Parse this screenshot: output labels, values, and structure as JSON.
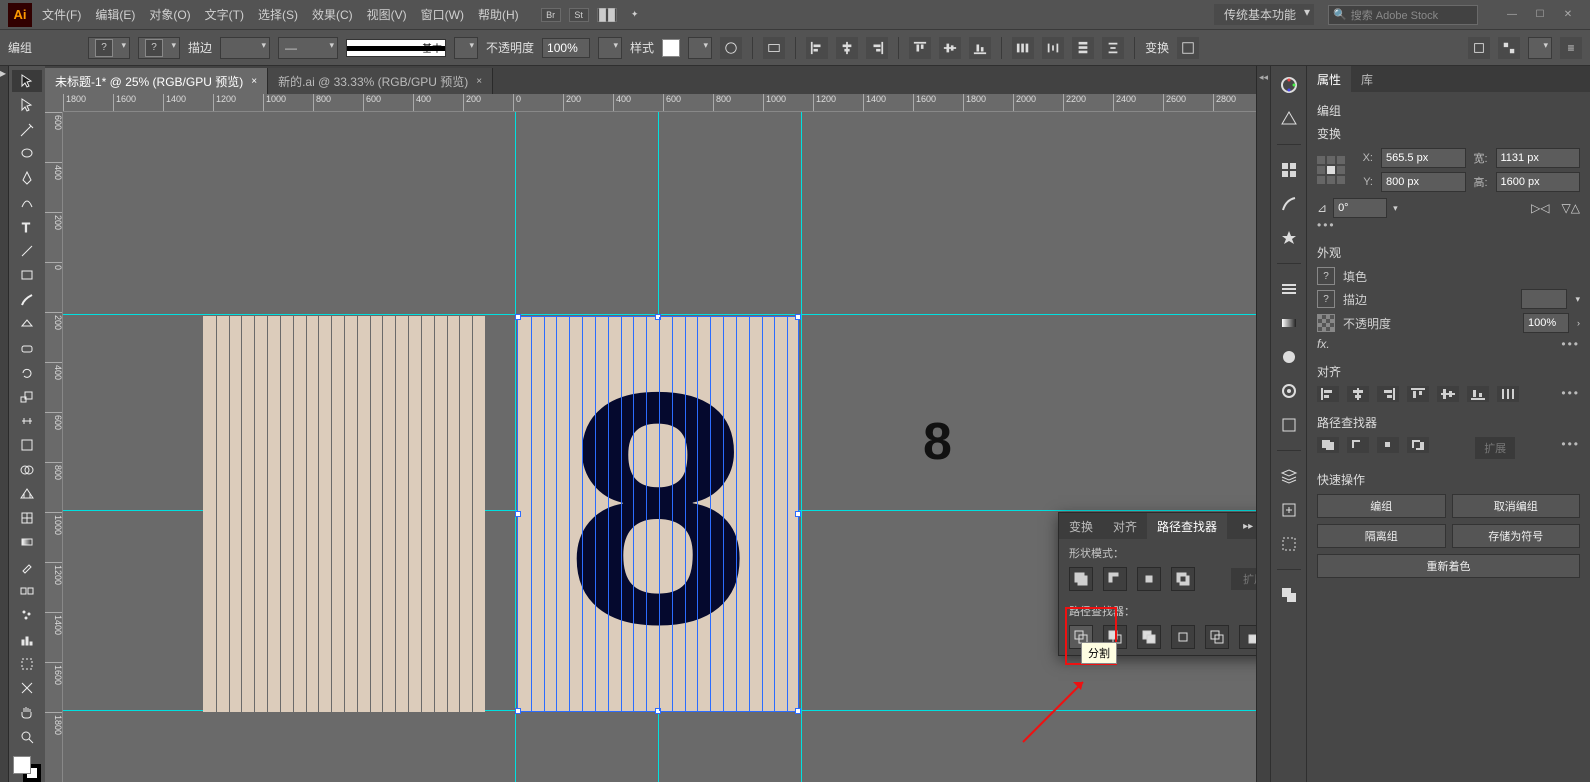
{
  "menu": {
    "items": [
      "文件(F)",
      "编辑(E)",
      "对象(O)",
      "文字(T)",
      "选择(S)",
      "效果(C)",
      "视图(V)",
      "窗口(W)",
      "帮助(H)"
    ],
    "br": "Br",
    "st": "St",
    "workspace": "传统基本功能",
    "search_placeholder": "搜索 Adobe Stock"
  },
  "options": {
    "sel_label": "编组",
    "stroke_label": "描边",
    "stroke_dash": "—",
    "basic": "基本",
    "opacity_label": "不透明度",
    "opacity": "100%",
    "style_label": "样式",
    "transform_label": "变换"
  },
  "tabs": [
    {
      "title": "未标题-1* @ 25% (RGB/GPU 预览)",
      "active": true
    },
    {
      "title": "新的.ai @ 33.33% (RGB/GPU 预览)",
      "active": false
    }
  ],
  "rulerH": [
    -1800,
    -1600,
    -1400,
    -1200,
    -1000,
    -800,
    -600,
    -400,
    -200,
    0,
    200,
    400,
    600,
    800,
    1000,
    1200,
    1400,
    1600,
    1800,
    2000,
    2200,
    2400,
    2600,
    2800
  ],
  "rulerV": [
    -600,
    -400,
    -200,
    0,
    200,
    400,
    600,
    800,
    1000,
    1200,
    1400,
    1600,
    1800
  ],
  "pathfinder": {
    "tabs": [
      "变换",
      "对齐",
      "路径查找器"
    ],
    "shape_label": "形状模式：",
    "pf_label": "路径查找器：",
    "expand": "扩展",
    "tooltip": "分割"
  },
  "props": {
    "tabs": [
      "属性",
      "库"
    ],
    "sel": "编组",
    "transform": "变换",
    "x": "565.5 px",
    "y": "800 px",
    "w": "1131 px",
    "h": "1600 px",
    "wl": "宽:",
    "hl": "高:",
    "angle": "0°",
    "appearance": "外观",
    "fill": "填色",
    "stroke": "描边",
    "opacity_l": "不透明度",
    "opacity_v": "100%",
    "fx": "fx.",
    "align": "对齐",
    "pathfinder": "路径查找器",
    "pf_expand": "扩展",
    "quick": "快速操作",
    "q_group": "编组",
    "q_ungroup": "取消编组",
    "q_iso": "隔离组",
    "q_sym": "存储为符号",
    "q_recolor": "重新着色"
  },
  "canvas": {
    "big8": "8",
    "small8": "8"
  }
}
